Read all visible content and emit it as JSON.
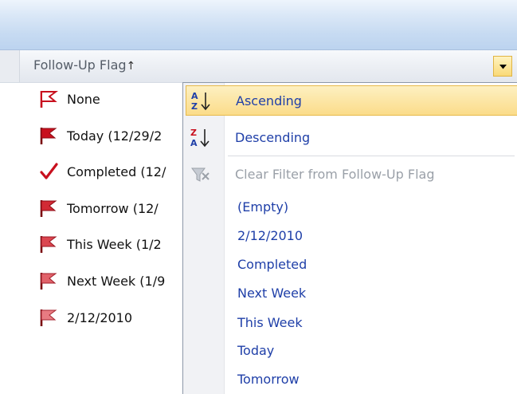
{
  "column_header": {
    "title": "Follow-Up Flag",
    "sort_indicator": "↑",
    "dropdown_icon": "dropdown-arrow-icon"
  },
  "rows": [
    {
      "label": "None",
      "icon": "outline-flag-icon"
    },
    {
      "label": "Today (12/29/2",
      "icon": "flag-icon"
    },
    {
      "label": "Completed (12/",
      "icon": "checkmark-icon"
    },
    {
      "label": "Tomorrow (12/",
      "icon": "flag-icon"
    },
    {
      "label": "This Week (1/2",
      "icon": "flag-icon"
    },
    {
      "label": "Next Week (1/9",
      "icon": "flag-icon"
    },
    {
      "label": "2/12/2010",
      "icon": "flag-icon"
    }
  ],
  "menu": {
    "ascending": "Ascending",
    "descending": "Descending",
    "clear_filter": "Clear Filter from Follow-Up Flag",
    "filter_values": [
      "(Empty)",
      "2/12/2010",
      "Completed",
      "Next Week",
      "This Week",
      "Today",
      "Tomorrow"
    ]
  },
  "colors": {
    "flag_red": "#c8101e",
    "menu_text_blue": "#1f3fa8",
    "highlight": "#fbdc8a"
  }
}
